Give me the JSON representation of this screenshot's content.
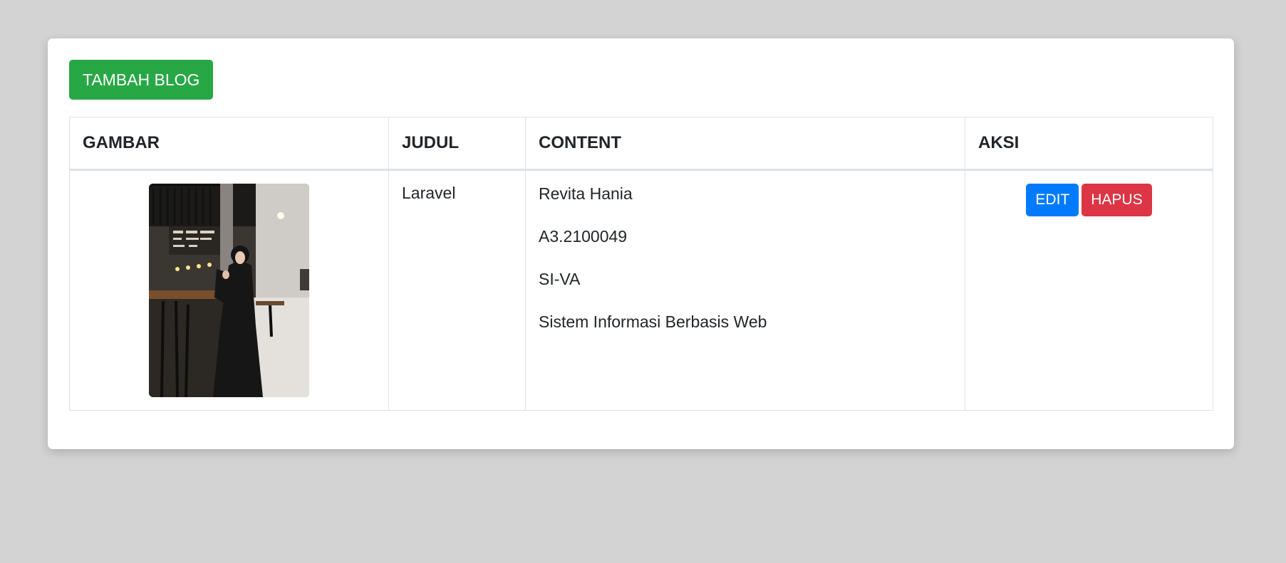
{
  "actions": {
    "add_label": "TAMBAH BLOG"
  },
  "table": {
    "headers": {
      "gambar": "GAMBAR",
      "judul": "JUDUL",
      "content": "CONTENT",
      "aksi": "AKSI"
    },
    "rows": [
      {
        "judul": "Laravel",
        "content_lines": [
          "Revita Hania",
          "A3.2100049",
          "SI-VA",
          "Sistem Informasi Berbasis Web"
        ],
        "edit_label": "EDIT",
        "delete_label": "HAPUS"
      }
    ]
  },
  "colors": {
    "page_background": "#d3d3d3",
    "add_button": "#28a745",
    "edit_button": "#007bff",
    "delete_button": "#dc3545"
  }
}
